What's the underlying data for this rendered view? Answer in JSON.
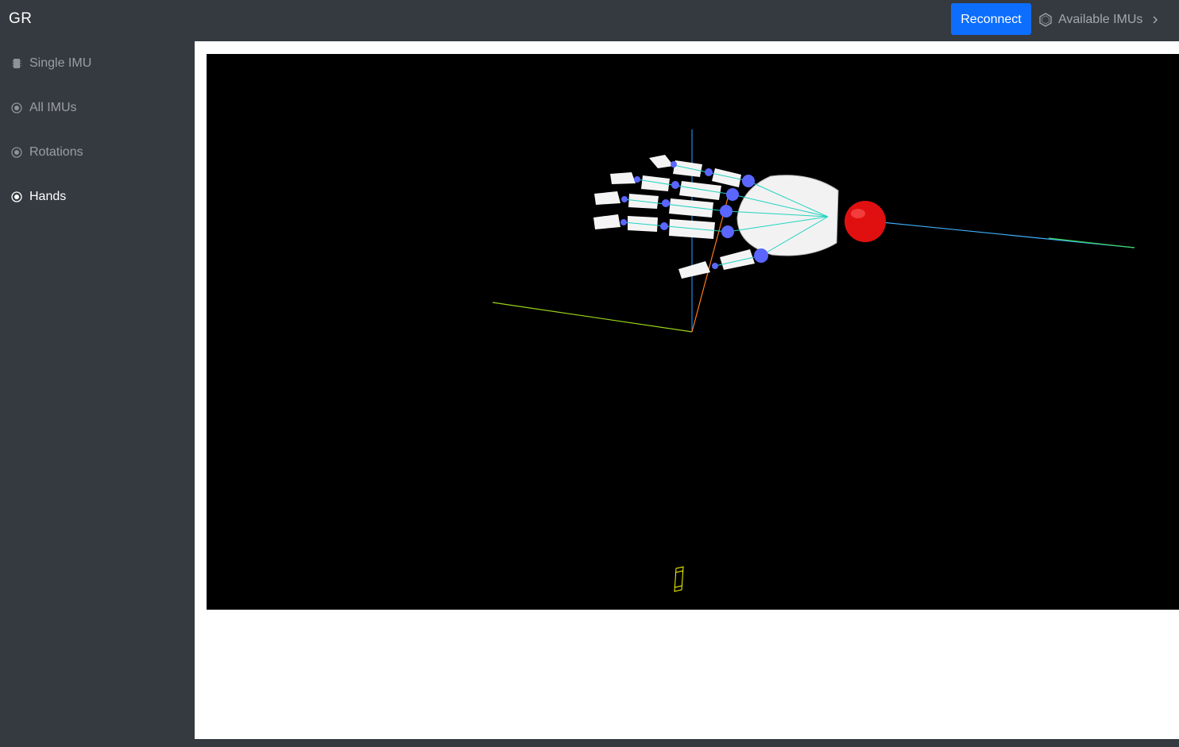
{
  "app": {
    "brand": "GR"
  },
  "header": {
    "reconnect_label": "Reconnect",
    "available_imus_label": "Available IMUs"
  },
  "sidebar": {
    "items": [
      {
        "label": "Single IMU",
        "icon": "device-icon",
        "active": false
      },
      {
        "label": "All IMUs",
        "icon": "target-icon",
        "active": false
      },
      {
        "label": "Rotations",
        "icon": "target-icon",
        "active": false
      },
      {
        "label": "Hands",
        "icon": "target-icon",
        "active": true
      }
    ]
  },
  "scene": {
    "background": "#000000",
    "hand_color": "#ffffff",
    "joint_color": "#5a66ff",
    "root_sphere_color": "#ff1a1a",
    "imu_marker_color": "#ffff00"
  },
  "colors": {
    "chrome": "#343a40",
    "accent": "#0d6efd"
  }
}
